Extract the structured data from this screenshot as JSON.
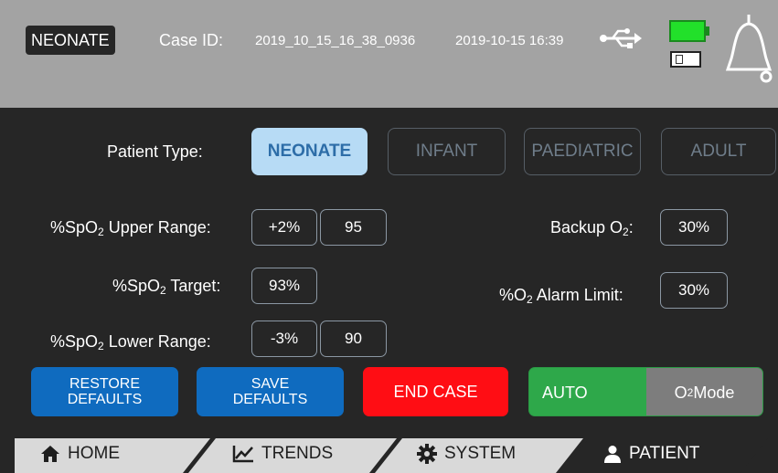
{
  "header": {
    "mode_badge": "NEONATE",
    "case_id_label": "Case ID:",
    "case_id": "2019_10_15_16_38_0936",
    "datetime": "2019-10-15 16:39",
    "icons": [
      "usb-icon",
      "battery-icon",
      "sd-card-icon",
      "bell-icon"
    ],
    "battery_color": "#22e02a"
  },
  "patient_type": {
    "label": "Patient Type:",
    "options": [
      "NEONATE",
      "INFANT",
      "PAEDIATRIC",
      "ADULT"
    ],
    "selected": "NEONATE"
  },
  "spo2_upper": {
    "label_pre": "%SpO",
    "label_sub": "2",
    "label_post": " Upper Range:",
    "offset": "+2%",
    "value": "95"
  },
  "spo2_target": {
    "label_pre": "%SpO",
    "label_sub": "2",
    "label_post": " Target:",
    "value": "93%"
  },
  "spo2_lower": {
    "label_pre": "%SpO",
    "label_sub": "2",
    "label_post": " Lower Range:",
    "offset": "-3%",
    "value": "90"
  },
  "backup_o2": {
    "label_pre": "Backup O",
    "label_sub": "2",
    "label_post": ":",
    "value": "30%"
  },
  "o2_alarm": {
    "label_pre": "%O",
    "label_sub": "2",
    "label_post": " Alarm Limit:",
    "value": "30%"
  },
  "actions": {
    "restore_line1": "RESTORE",
    "restore_line2": "DEFAULTS",
    "save_line1": "SAVE",
    "save_line2": "DEFAULTS",
    "end_case": "END CASE"
  },
  "mode_toggle": {
    "auto": "AUTO",
    "o2_pre": "O",
    "o2_sub": "2",
    "o2_post": " Mode"
  },
  "tabs": [
    {
      "label": "HOME",
      "icon": "home-icon"
    },
    {
      "label": "TRENDS",
      "icon": "chart-icon"
    },
    {
      "label": "SYSTEM",
      "icon": "gear-icon"
    },
    {
      "label": "PATIENT",
      "icon": "user-icon"
    }
  ],
  "active_tab": "PATIENT",
  "colors": {
    "header_bg": "#a3a3a3",
    "body_bg": "#262626",
    "selected_type": "#b7dbf5",
    "action_blue": "#0f6bbf",
    "end_case_red": "#ff0d14",
    "auto_green": "#2ea84a",
    "o2_mode_grey": "#7d7d7d"
  }
}
